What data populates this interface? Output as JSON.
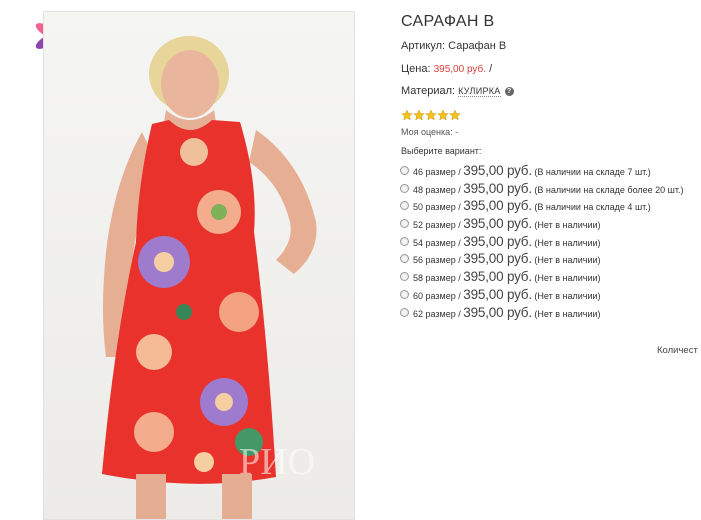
{
  "product": {
    "title": "САРАФАН В",
    "sku_label": "Артикул:",
    "sku_value": "Сарафан В",
    "price_label": "Цена:",
    "price_value": "395,00 руб.",
    "price_suffix": "/",
    "material_label": "Материал:",
    "material_value": "КУЛИРКА",
    "help_icon": "?"
  },
  "rating": {
    "stars": 5,
    "my_rating_label": "Моя оценка: -"
  },
  "variants_title": "Выберите вариант:",
  "variants": [
    {
      "size": "46 размер",
      "sep": "/",
      "price": "395,00 руб.",
      "stock": "(В наличии на складе 7 шт.)"
    },
    {
      "size": "48 размер",
      "sep": "/",
      "price": "395,00 руб.",
      "stock": "(В наличии на складе более 20 шт.)"
    },
    {
      "size": "50 размер",
      "sep": "/",
      "price": "395,00 руб.",
      "stock": "(В наличии на складе 4 шт.)"
    },
    {
      "size": "52 размер",
      "sep": "/",
      "price": "395,00 руб.",
      "stock": "(Нет в наличии)"
    },
    {
      "size": "54 размер",
      "sep": "/",
      "price": "395,00 руб.",
      "stock": "(Нет в наличии)"
    },
    {
      "size": "56 размер",
      "sep": "/",
      "price": "395,00 руб.",
      "stock": "(Нет в наличии)"
    },
    {
      "size": "58 размер",
      "sep": "/",
      "price": "395,00 руб.",
      "stock": "(Нет в наличии)"
    },
    {
      "size": "60 размер",
      "sep": "/",
      "price": "395,00 руб.",
      "stock": "(Нет в наличии)"
    },
    {
      "size": "62 размер",
      "sep": "/",
      "price": "395,00 руб.",
      "stock": "(Нет в наличии)"
    }
  ],
  "quantity_label": "Количест",
  "watermark": "РИО",
  "colors": {
    "price_red": "#d9413b",
    "dress_red": "#e8322b",
    "star_gold": "#f2c11c"
  },
  "icons": {
    "logo": "flower-logo",
    "help": "question-circle-icon",
    "star": "star-icon",
    "radio": "radio-unchecked"
  }
}
